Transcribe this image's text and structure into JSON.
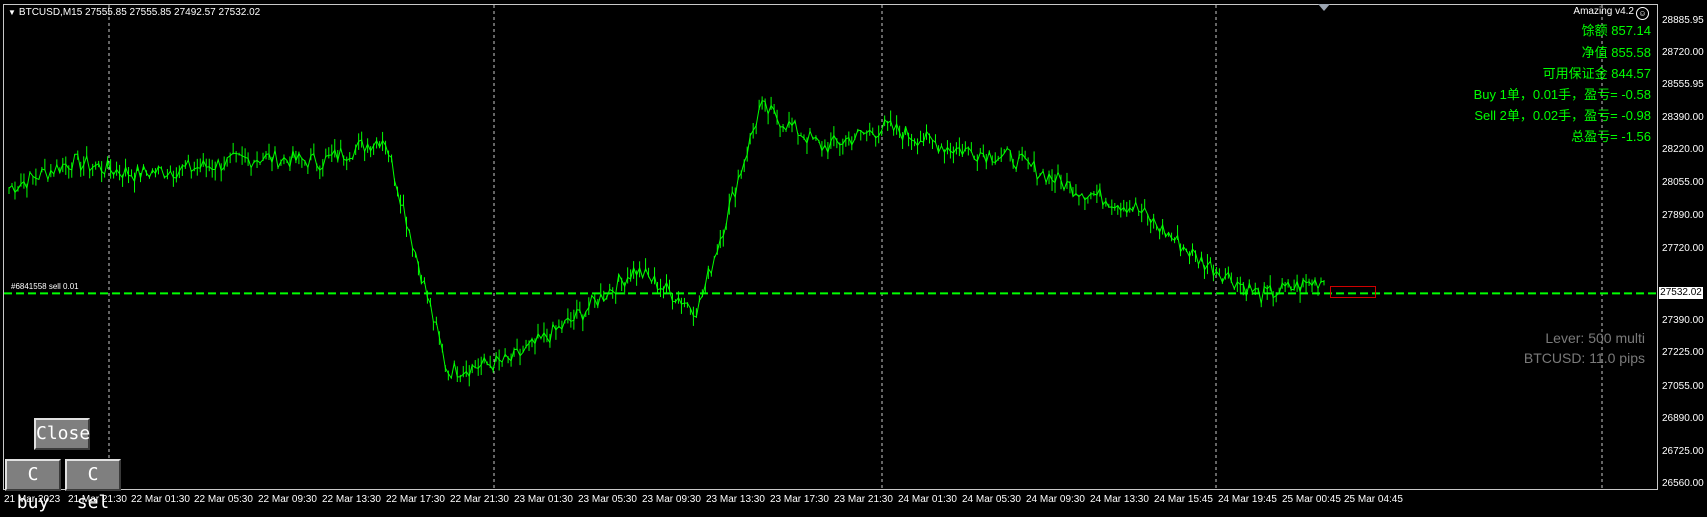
{
  "header": {
    "symbol_line": "BTCUSD,M15  27555.85 27555.85 27492.57 27532.02",
    "ea_name": "Amazing v4.2"
  },
  "info_panel": {
    "balance": "馀额 857.14",
    "equity": "净值 855.58",
    "free_margin": "可用保证金 844.57",
    "buy_summary": "Buy 1单，0.01手，盈亏= -0.58",
    "sell_summary": "Sell 2单，0.02手，盈亏= -0.98",
    "total_pnl": "总盈亏= -1.56"
  },
  "lever_panel": {
    "lever": "Lever: 500 multi",
    "spread": "BTCUSD: 11.0 pips"
  },
  "order_line": {
    "label": "#6841558 sell 0.01",
    "color": "#00ff00"
  },
  "price_axis": {
    "ticks": [
      "28885.95",
      "28720.00",
      "28555.95",
      "28390.00",
      "28220.00",
      "28055.00",
      "27890.00",
      "27720.00",
      "27390.00",
      "27225.00",
      "27055.00",
      "26890.00",
      "26725.00",
      "26560.00"
    ],
    "current_price": "27532.02"
  },
  "time_axis": {
    "ticks": [
      "21 Mar 2023",
      "21 Mar 21:30",
      "22 Mar 01:30",
      "22 Mar 05:30",
      "22 Mar 09:30",
      "22 Mar 13:30",
      "22 Mar 17:30",
      "22 Mar 21:30",
      "23 Mar 01:30",
      "23 Mar 05:30",
      "23 Mar 09:30",
      "23 Mar 13:30",
      "23 Mar 17:30",
      "23 Mar 21:30",
      "24 Mar 01:30",
      "24 Mar 05:30",
      "24 Mar 09:30",
      "24 Mar 13:30",
      "24 Mar 15:45",
      "24 Mar 19:45",
      "25 Mar 00:45",
      "25 Mar 04:45"
    ]
  },
  "buttons": {
    "close": "Close",
    "close_buy": "C buy",
    "close_sell": "C sel"
  },
  "colors": {
    "background": "#000000",
    "candle": "#00ff00",
    "grid": "#c8c8c8",
    "text": "#ffffff",
    "info_text": "#00ff00",
    "lever_text": "#7a7a7a"
  },
  "chart_data": {
    "type": "line",
    "title": "BTCUSD,M15",
    "xlabel": "",
    "ylabel": "",
    "x": [
      "21 Mar 2023",
      "21 Mar 21:30",
      "22 Mar 01:30",
      "22 Mar 05:30",
      "22 Mar 09:30",
      "22 Mar 13:30",
      "22 Mar 17:30",
      "22 Mar 21:30",
      "23 Mar 01:30",
      "23 Mar 05:30",
      "23 Mar 09:30",
      "23 Mar 13:30",
      "23 Mar 17:30",
      "23 Mar 21:30",
      "24 Mar 01:30",
      "24 Mar 05:30",
      "24 Mar 09:30",
      "24 Mar 13:30",
      "24 Mar 15:45",
      "24 Mar 19:45",
      "25 Mar 00:45",
      "25 Mar 04:45"
    ],
    "series": [
      {
        "name": "BTCUSD",
        "values": [
          28050,
          28180,
          28120,
          28150,
          28200,
          28180,
          28300,
          27150,
          27200,
          27400,
          27650,
          27450,
          28450,
          28250,
          28350,
          28250,
          28200,
          28050,
          27950,
          27700,
          27520,
          27600
        ]
      }
    ],
    "ylim": [
      26560,
      28950
    ],
    "grid": true,
    "horizontal_lines": [
      27532.02
    ]
  }
}
